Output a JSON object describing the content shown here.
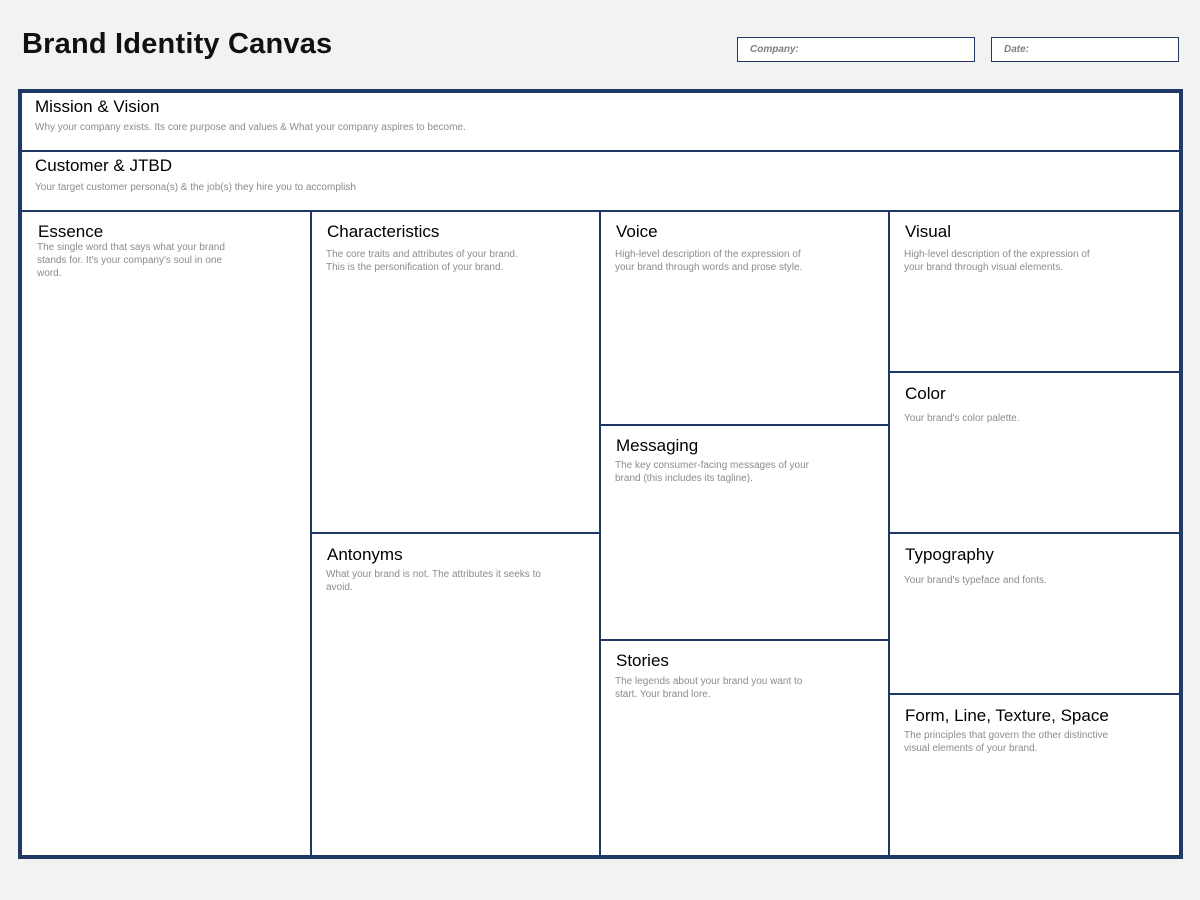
{
  "page": {
    "title": "Brand Identity Canvas"
  },
  "fields": {
    "company_label": "Company:",
    "date_label": "Date:"
  },
  "sections": {
    "mission": {
      "title": "Mission & Vision",
      "desc": "Why your company exists. Its core purpose and values & What your company aspires to become."
    },
    "customer": {
      "title": "Customer & JTBD",
      "desc": "Your target customer persona(s) & the job(s) they hire you to accomplish"
    },
    "essence": {
      "title": "Essence",
      "desc": "The single word that says what your brand stands for. It's your company's soul in one word."
    },
    "characteristics": {
      "title": "Characteristics",
      "desc": "The core traits and attributes of your brand. This is the personification of your brand."
    },
    "antonyms": {
      "title": "Antonyms",
      "desc": "What your brand is not. The attributes it seeks to avoid."
    },
    "voice": {
      "title": "Voice",
      "desc": "High-level description of the expression of your brand through words and prose style."
    },
    "messaging": {
      "title": "Messaging",
      "desc": "The key consumer-facing messages of your brand (this includes its tagline)."
    },
    "stories": {
      "title": "Stories",
      "desc": "The legends about your brand you want to start. Your brand lore."
    },
    "visual": {
      "title": "Visual",
      "desc": "High-level description of the expression of your brand through visual elements."
    },
    "color": {
      "title": "Color",
      "desc": "Your brand's color palette."
    },
    "typography": {
      "title": "Typography",
      "desc": "Your brand's typeface and fonts."
    },
    "form": {
      "title": "Form, Line, Texture, Space",
      "desc": "The principles that govern the other distinctive visual elements of your brand."
    }
  },
  "colors": {
    "border": "#1f3864",
    "background": "#f2f2f2",
    "description_text": "#8c8c8c"
  }
}
